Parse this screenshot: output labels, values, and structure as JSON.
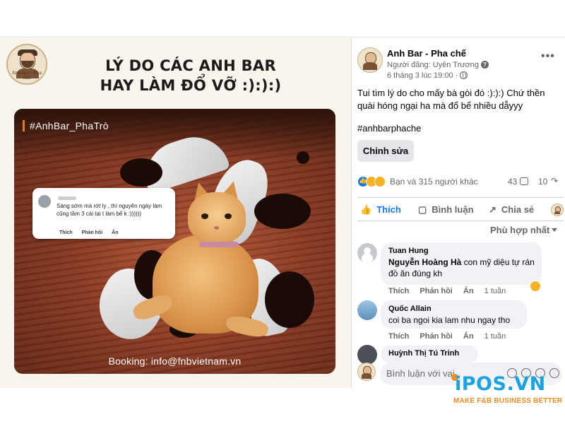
{
  "post_image": {
    "logo_text": "Anh Bar - Pha chế",
    "headline_line1": "LÝ DO CÁC ANH BAR",
    "headline_line2": "HAY LÀM ĐỔ VỠ :):):)",
    "hashtag": "#AnhBar_PhaTrò",
    "inset_comment": "Sáng sớm mà rớt ly , thì nguyên ngày làm cũng tầm 3 cái tại t làm bể k :))))))",
    "inset_actions": [
      "Thích",
      "Phản hồi",
      "Ẩn"
    ],
    "booking": "Booking: info@fnbvietnam.vn"
  },
  "post": {
    "page_name": "Anh Bar - Pha chế",
    "author": "Người đăng: Uyên Trương",
    "time": "6 tháng 3 lúc 19:00 ·",
    "more": "•••",
    "text": "Tui tìm lý do cho mấy bà gòi đó :):):) Chứ thền quài hóng ngại ha mà đổ bể nhiều dẫyyy",
    "hashtag": "#anhbarphache",
    "edit_label": "Chỉnh sửa"
  },
  "reactions": {
    "summary": "Bạn và 315 người khác",
    "comments": "43",
    "shares": "10"
  },
  "actions": {
    "like": "Thích",
    "comment": "Bình luận",
    "share": "Chia sẻ"
  },
  "sort": {
    "label": "Phù hợp nhất"
  },
  "comments": [
    {
      "name": "Tuan Hung",
      "tag": "Nguyễn Hoàng Hà",
      "text": " con mỹ diệu tự rán đồ ăn đúng kh",
      "like": "Thích",
      "reply": "Phản hồi",
      "hide": "Ẩn",
      "time": "1 tuần"
    },
    {
      "name": "Quốc Allain",
      "text": "coi ba ngoi kia lam nhu ngay tho",
      "like": "Thích",
      "reply": "Phản hồi",
      "hide": "Ẩn",
      "time": "1 tuần"
    },
    {
      "name": "Huỳnh Thị Tú Trinh"
    }
  ],
  "composer": {
    "placeholder": "Bình luận với vai"
  },
  "watermark": {
    "brand": "iPOS.VN",
    "tagline": "MAKE F&B BUSINESS BETTER"
  },
  "colors": {
    "accent": "#1877f2",
    "ipos_blue": "#1aa3e0",
    "ipos_orange": "#f28c28"
  }
}
